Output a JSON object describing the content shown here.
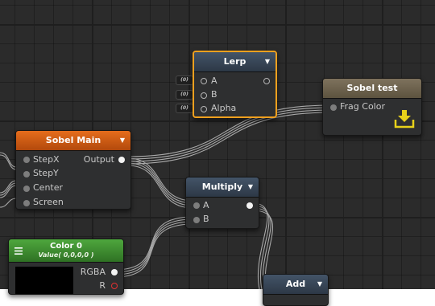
{
  "canvas": {
    "grid": true,
    "background": "#2b2b2b"
  },
  "nodes": {
    "lerp": {
      "title": "Lerp",
      "inputs": [
        "A",
        "B",
        "Alpha"
      ],
      "inline_values": [
        "(0)",
        "(0)",
        "(0)"
      ],
      "selected": true,
      "selection_color": "#f0a01e"
    },
    "sobel_test": {
      "title": "Sobel test",
      "input": "Frag Color",
      "icon": "output-download-icon",
      "icon_color": "#e8d21a"
    },
    "sobel_main": {
      "title": "Sobel Main",
      "output": "Output",
      "inputs": [
        "StepX",
        "StepY",
        "Center",
        "Screen"
      ],
      "header_color": "#e56d1c"
    },
    "multiply": {
      "title": "Multiply",
      "inputs": [
        "A",
        "B"
      ]
    },
    "color0": {
      "title": "Color 0",
      "subtitle": "Value( 0,0,0,0 )",
      "outputs": [
        "RGBA",
        "R"
      ],
      "icon": "hamburger-menu-icon",
      "header_color": "#4ea73d"
    },
    "add": {
      "title": "Add"
    }
  },
  "dropdown_arrow": "▼"
}
